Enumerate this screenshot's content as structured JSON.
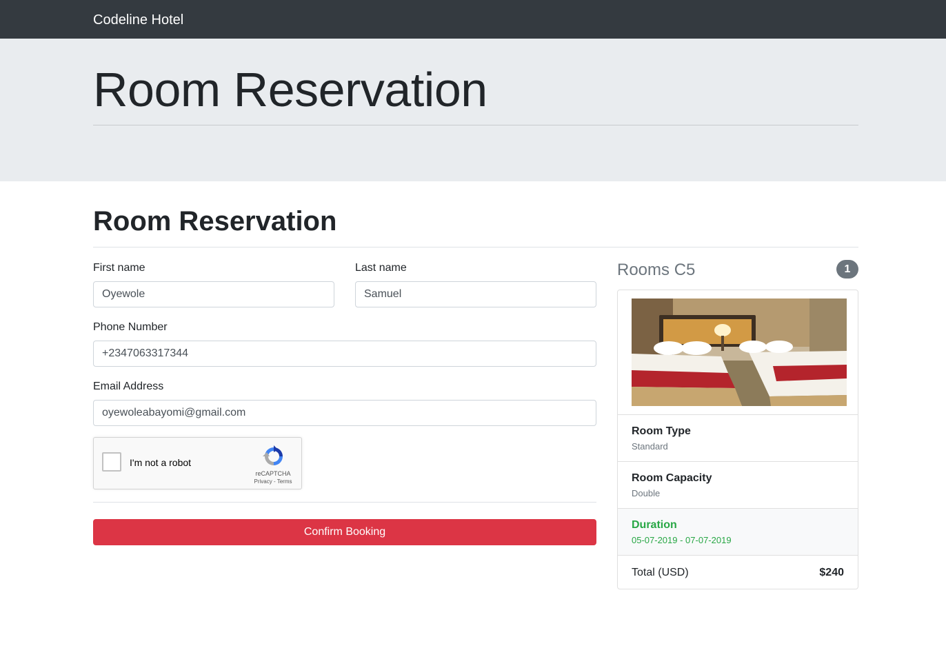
{
  "navbar": {
    "brand": "Codeline Hotel"
  },
  "jumbotron": {
    "title": "Room Reservation"
  },
  "form": {
    "section_title": "Room Reservation",
    "first_name": {
      "label": "First name",
      "value": "Oyewole"
    },
    "last_name": {
      "label": "Last name",
      "value": "Samuel"
    },
    "phone": {
      "label": "Phone Number",
      "value": "+2347063317344"
    },
    "email": {
      "label": "Email Address",
      "value": "oyewoleabayomi@gmail.com"
    },
    "recaptcha": {
      "text": "I'm not a robot",
      "brand": "reCAPTCHA",
      "links": "Privacy - Terms"
    },
    "confirm_label": "Confirm Booking"
  },
  "summary": {
    "heading": "Rooms C5",
    "badge_count": "1",
    "image_icon": "hotel-room-photo",
    "room_type": {
      "label": "Room Type",
      "value": "Standard"
    },
    "room_capacity": {
      "label": "Room Capacity",
      "value": "Double"
    },
    "duration": {
      "label": "Duration",
      "value": "05-07-2019 - 07-07-2019"
    },
    "total": {
      "label": "Total (USD)",
      "value": "$240"
    }
  },
  "colors": {
    "navbar": "#343a40",
    "jumbotron": "#e9ecef",
    "danger": "#dc3545",
    "success": "#28a745",
    "muted": "#6c757d"
  }
}
